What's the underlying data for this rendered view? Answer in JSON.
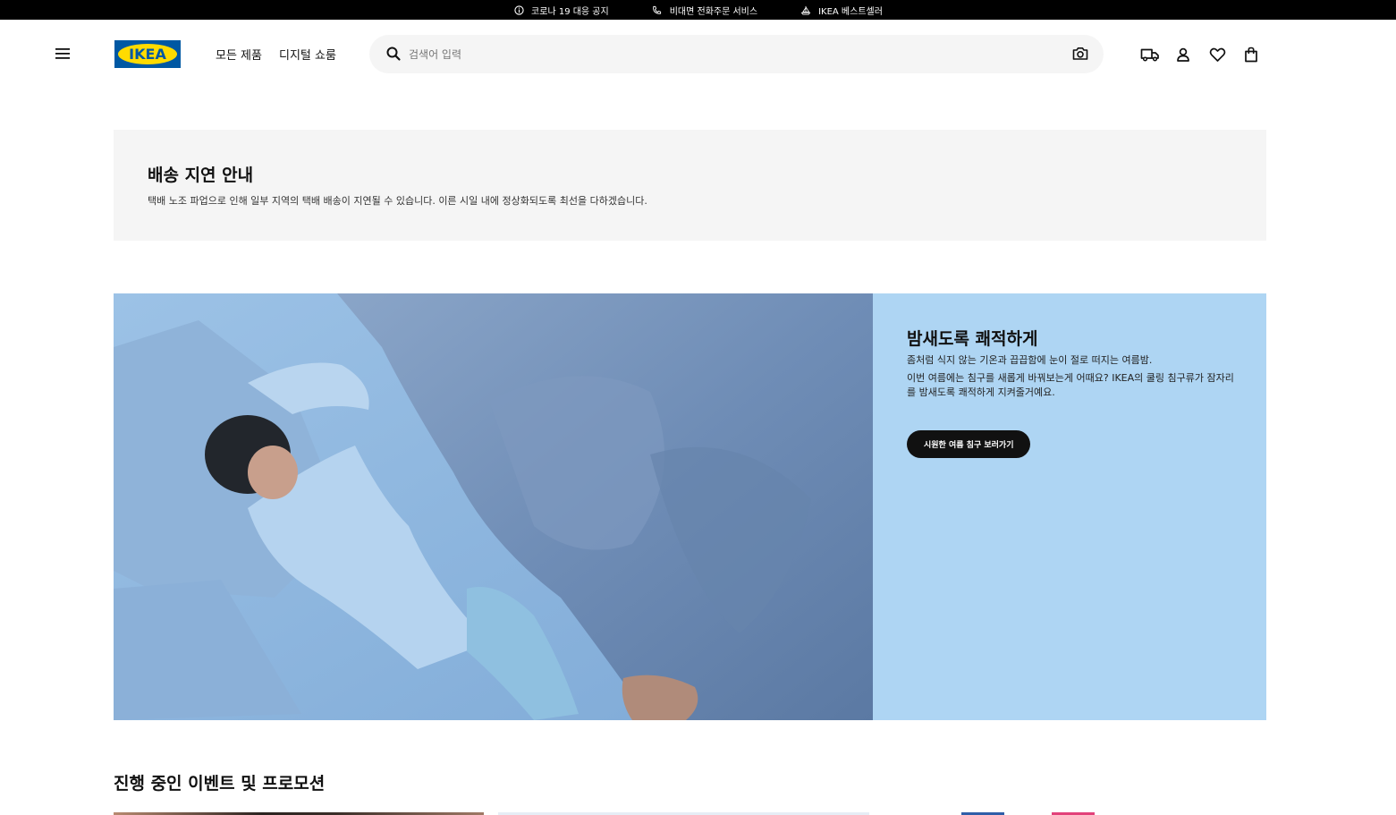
{
  "topbar": {
    "items": [
      {
        "icon": "info-icon",
        "label": "코로나 19 대응 공지"
      },
      {
        "icon": "phone-icon",
        "label": "비대면 전화주문 서비스"
      },
      {
        "icon": "boat-icon",
        "label": "IKEA 베스트셀러"
      }
    ]
  },
  "header": {
    "logo_text": "IKEA",
    "nav": [
      "모든 제품",
      "디지털 쇼룸"
    ],
    "search_placeholder": "검색어 입력",
    "icons": [
      "delivery-truck-icon",
      "user-icon",
      "heart-icon",
      "shopping-bag-icon"
    ]
  },
  "notice": {
    "title": "배송 지연 안내",
    "text": "택배 노조 파업으로 인해 일부 지역의 택배 배송이 지연될 수 있습니다. 이른 시일 내에 정상화되도록 최선을 다하겠습니다."
  },
  "hero": {
    "title": "밤새도록 쾌적하게",
    "line1": "좀처럼 식지 않는 기온과 끕끕함에 눈이 절로 떠지는 여름밤.",
    "line2": "이번 여름에는 침구를 새롭게 바꿔보는게 어때요? IKEA의 쿨링 침구류가 잠자리를 밤새도록 쾌적하게 지켜줄거예요.",
    "cta": "시원한 여름 침구 보러가기"
  },
  "events": {
    "title": "진행 중인 이벤트 및 프로모션"
  },
  "colors": {
    "brand_blue": "#0058a3",
    "brand_yellow": "#ffdb00",
    "hero_panel": "#aed5f3",
    "notice_bg": "#f5f5f5"
  }
}
